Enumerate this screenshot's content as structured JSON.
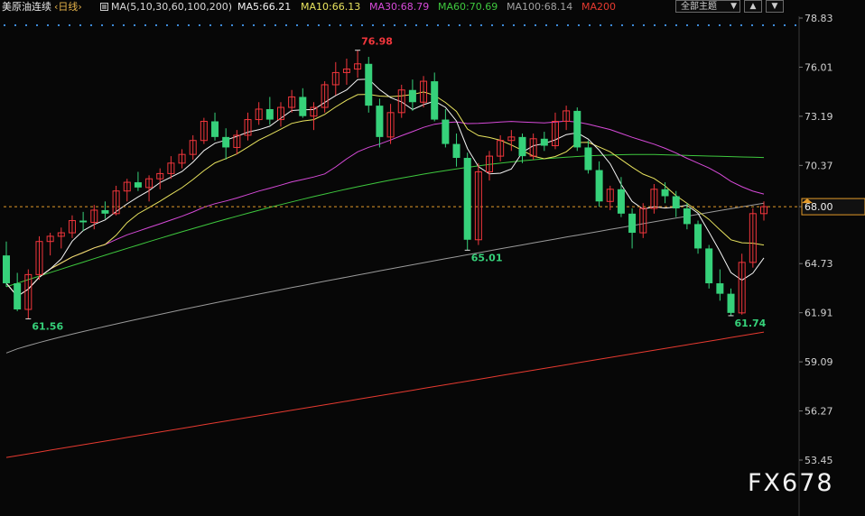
{
  "header": {
    "instrument": "美原油连续",
    "period": "‹日线›",
    "ma_params": "MA(5,10,30,60,100,200)",
    "ma5": "MA5:66.21",
    "ma10": "MA10:66.13",
    "ma30": "MA30:68.79",
    "ma60": "MA60:70.69",
    "ma100": "MA100:68.14",
    "ma200": "MA200",
    "theme": "全部主题",
    "up_icon": "triangle-up-icon",
    "down_icon": "triangle-down-icon"
  },
  "colors": {
    "up": "#f2363c",
    "down": "#36d17a",
    "ma5": "#f4f4f4",
    "ma10": "#e8e35e",
    "ma30": "#d64ad8",
    "ma60": "#3ec83e",
    "ma100": "#9a9a9a",
    "ma200": "#e63a30",
    "axis_text": "#d0d0d0",
    "current_price": "#e39a2a"
  },
  "watermark": "FX678",
  "chart_data": {
    "type": "candlestick",
    "y_ticks": [
      "78.83",
      "76.01",
      "73.19",
      "70.37",
      "68.00",
      "64.73",
      "61.91",
      "59.09",
      "56.27",
      "53.45"
    ],
    "ylim": [
      53.45,
      78.83
    ],
    "current_price": "68.00",
    "annotations": [
      {
        "text": "76.98",
        "kind": "high"
      },
      {
        "text": "61.56",
        "kind": "low"
      },
      {
        "text": "65.01",
        "kind": "low"
      },
      {
        "text": "61.74",
        "kind": "low"
      }
    ],
    "candles": [
      [
        65.2,
        66.0,
        63.4,
        63.6
      ],
      [
        63.6,
        64.2,
        62.0,
        62.1
      ],
      [
        62.1,
        64.4,
        61.56,
        64.1
      ],
      [
        64.1,
        66.3,
        63.8,
        66.0
      ],
      [
        66.0,
        66.5,
        65.2,
        66.3
      ],
      [
        66.3,
        66.8,
        65.6,
        66.5
      ],
      [
        66.5,
        67.5,
        66.2,
        67.2
      ],
      [
        67.2,
        67.7,
        66.6,
        67.1
      ],
      [
        67.1,
        68.1,
        66.7,
        67.8
      ],
      [
        67.8,
        68.3,
        67.3,
        67.6
      ],
      [
        67.6,
        69.2,
        67.5,
        68.9
      ],
      [
        68.9,
        69.6,
        68.3,
        69.4
      ],
      [
        69.4,
        70.0,
        68.9,
        69.1
      ],
      [
        69.1,
        69.8,
        68.3,
        69.6
      ],
      [
        69.6,
        70.2,
        69.0,
        69.9
      ],
      [
        69.9,
        70.9,
        69.6,
        70.5
      ],
      [
        70.5,
        71.3,
        70.2,
        71.0
      ],
      [
        71.0,
        72.1,
        70.7,
        71.8
      ],
      [
        71.8,
        73.1,
        71.6,
        72.9
      ],
      [
        72.9,
        73.4,
        71.8,
        72.0
      ],
      [
        72.0,
        72.5,
        70.7,
        71.4
      ],
      [
        71.4,
        72.4,
        71.0,
        72.1
      ],
      [
        72.1,
        73.4,
        71.8,
        73.0
      ],
      [
        73.0,
        74.0,
        72.7,
        73.6
      ],
      [
        73.6,
        74.3,
        72.7,
        73.0
      ],
      [
        73.0,
        74.0,
        72.6,
        73.7
      ],
      [
        73.7,
        74.7,
        73.4,
        74.3
      ],
      [
        74.3,
        74.8,
        73.1,
        73.2
      ],
      [
        73.2,
        74.0,
        72.4,
        73.7
      ],
      [
        73.7,
        75.2,
        73.4,
        75.0
      ],
      [
        75.0,
        76.3,
        74.4,
        75.7
      ],
      [
        75.7,
        76.5,
        75.0,
        75.9
      ],
      [
        75.9,
        76.98,
        75.4,
        76.2
      ],
      [
        76.2,
        76.6,
        73.4,
        73.8
      ],
      [
        73.8,
        74.2,
        71.4,
        72.0
      ],
      [
        72.0,
        73.9,
        71.6,
        73.4
      ],
      [
        73.4,
        75.0,
        73.1,
        74.7
      ],
      [
        74.7,
        75.3,
        73.5,
        74.0
      ],
      [
        74.0,
        75.5,
        73.7,
        75.2
      ],
      [
        75.2,
        75.7,
        72.9,
        73.0
      ],
      [
        73.0,
        73.6,
        71.4,
        71.6
      ],
      [
        71.6,
        72.2,
        70.3,
        70.8
      ],
      [
        70.8,
        71.1,
        65.5,
        66.1
      ],
      [
        66.1,
        70.5,
        65.8,
        70.0
      ],
      [
        70.0,
        71.2,
        69.5,
        70.9
      ],
      [
        70.9,
        72.1,
        70.6,
        71.8
      ],
      [
        71.8,
        72.4,
        71.2,
        72.0
      ],
      [
        72.0,
        72.2,
        70.5,
        70.9
      ],
      [
        70.9,
        72.2,
        70.7,
        71.9
      ],
      [
        71.9,
        72.3,
        71.2,
        71.5
      ],
      [
        71.5,
        73.4,
        71.3,
        72.9
      ],
      [
        72.9,
        73.8,
        72.4,
        73.5
      ],
      [
        73.5,
        73.7,
        71.2,
        71.4
      ],
      [
        71.4,
        71.8,
        69.9,
        70.1
      ],
      [
        70.1,
        70.6,
        68.0,
        68.3
      ],
      [
        68.3,
        69.2,
        67.8,
        69.0
      ],
      [
        69.0,
        69.7,
        67.4,
        67.6
      ],
      [
        67.6,
        67.9,
        65.6,
        66.5
      ],
      [
        66.5,
        68.2,
        66.2,
        67.9
      ],
      [
        67.9,
        69.3,
        67.6,
        69.0
      ],
      [
        69.0,
        69.4,
        68.2,
        68.6
      ],
      [
        68.6,
        68.9,
        67.4,
        67.9
      ],
      [
        67.9,
        68.2,
        66.7,
        67.0
      ],
      [
        67.0,
        67.2,
        65.3,
        65.6
      ],
      [
        65.6,
        65.8,
        63.3,
        63.6
      ],
      [
        63.6,
        64.4,
        62.6,
        63.0
      ],
      [
        63.0,
        63.3,
        61.74,
        61.9
      ],
      [
        61.9,
        65.3,
        61.8,
        64.8
      ],
      [
        64.8,
        67.9,
        64.5,
        67.6
      ],
      [
        67.6,
        68.3,
        67.2,
        68.0
      ]
    ]
  }
}
